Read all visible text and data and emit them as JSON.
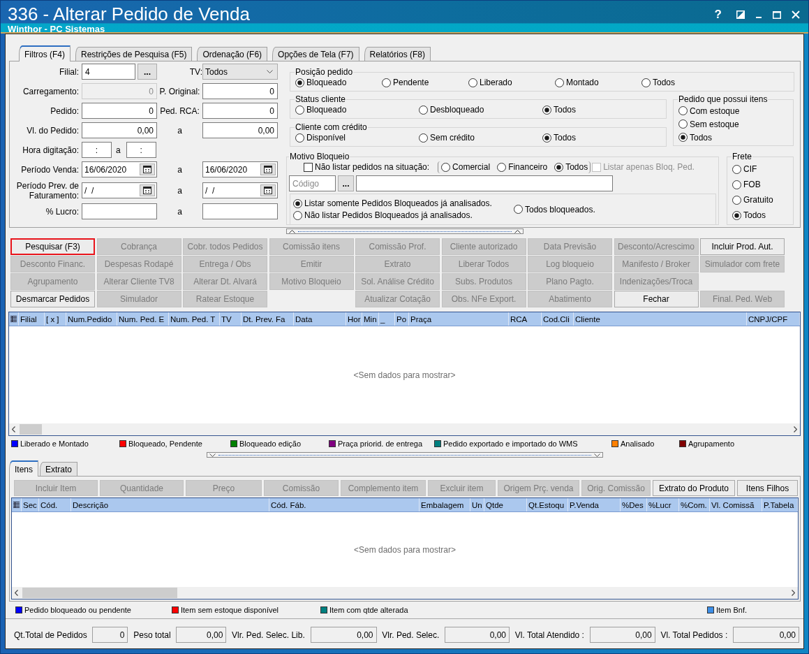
{
  "window": {
    "title": "336 - Alterar Pedido de Venda",
    "subtitle": "Winthor - PC Sistemas",
    "help": "?"
  },
  "tabs": [
    {
      "label": "Filtros (F4)",
      "selected": true
    },
    {
      "label": "Restrições de Pesquisa (F5)",
      "selected": false
    },
    {
      "label": "Ordenação (F6)",
      "selected": false
    },
    {
      "label": "Opções de Tela (F7)",
      "selected": false
    },
    {
      "label": "Relatórios (F8)",
      "selected": false
    }
  ],
  "filters": {
    "rows": [
      {
        "kind": "lookup",
        "label": "Filial:",
        "value": "4",
        "button": "...",
        "label_2": "TV:",
        "select": "Todos"
      },
      {
        "kind": "fields",
        "label": "Carregamento:",
        "from": {
          "value": "0",
          "disabled": true
        },
        "separator": "P. Original:",
        "to": {
          "value": "0",
          "disabled": false
        }
      },
      {
        "kind": "fields",
        "label": "Pedido:",
        "from": {
          "value": "0",
          "disabled": false
        },
        "separator": "Ped. RCA:",
        "to": {
          "value": "0",
          "disabled": false
        }
      },
      {
        "kind": "fields",
        "label": "Vl. do Pedido:",
        "from": {
          "value": "0,00",
          "disabled": false
        },
        "separator": "a",
        "to": {
          "value": "0,00",
          "disabled": false
        }
      },
      {
        "kind": "time",
        "label": "Hora digitação:",
        "from": {
          "value": ":"
        },
        "separator": "a",
        "to": {
          "value": ":"
        }
      },
      {
        "kind": "date",
        "label": "Período Venda:",
        "from": {
          "value": "16/06/2020"
        },
        "separator": "a",
        "to": {
          "value": "16/06/2020"
        }
      },
      {
        "kind": "date",
        "label": "Período Prev. de Faturamento:",
        "from": {
          "value": "/  /"
        },
        "separator": "a",
        "to": {
          "value": "/  /"
        }
      },
      {
        "kind": "fields",
        "label": "% Lucro:",
        "from": {
          "disabled": false
        },
        "separator": "a",
        "to": {
          "disabled": false
        }
      }
    ]
  },
  "order_position": {
    "legend": "Posição pedido",
    "options": [
      {
        "label": "Bloqueado",
        "selected": true
      },
      {
        "label": "Pendente",
        "selected": false
      },
      {
        "label": "Liberado",
        "selected": false
      },
      {
        "label": "Montado",
        "selected": false
      },
      {
        "label": "Todos",
        "selected": false
      }
    ]
  },
  "client_status": {
    "legend": "Status cliente",
    "options": [
      {
        "label": "Bloqueado",
        "selected": false
      },
      {
        "label": "Desbloqueado",
        "selected": false
      },
      {
        "label": "Todos",
        "selected": true
      }
    ]
  },
  "client_credit": {
    "legend": "Cliente com crédito",
    "options": [
      {
        "label": "Disponível",
        "selected": false
      },
      {
        "label": "Sem crédito",
        "selected": false
      },
      {
        "label": "Todos",
        "selected": true
      }
    ]
  },
  "order_items": {
    "legend": "Pedido que possui itens",
    "options": [
      {
        "label": "Com estoque",
        "selected": false
      },
      {
        "label": "Sem estoque",
        "selected": false
      },
      {
        "label": "Todos",
        "selected": true
      }
    ]
  },
  "block_reason": {
    "legend": "Motivo Bloqueio",
    "exclude": {
      "label": "Não listar pedidos na situação:",
      "checked": false
    },
    "situation": [
      {
        "label": "Comercial",
        "selected": false
      },
      {
        "label": "Financeiro",
        "selected": false
      },
      {
        "label": "Todos",
        "selected": true
      }
    ],
    "only_blocked": {
      "label": "Listar apenas Bloq. Ped.",
      "checked": false,
      "disabled": true
    },
    "code": {
      "placeholder": "Código",
      "button": "..."
    },
    "analysis": [
      {
        "label": "Listar somente Pedidos Bloqueados já analisados.",
        "selected": true
      },
      {
        "label": "Não listar Pedidos Bloqueados já analisados.",
        "selected": false
      },
      {
        "label": "Todos bloqueados.",
        "selected": false
      }
    ]
  },
  "freight": {
    "legend": "Frete",
    "options": [
      {
        "label": "CIF",
        "selected": false
      },
      {
        "label": "FOB",
        "selected": false
      },
      {
        "label": "Gratuito",
        "selected": false
      },
      {
        "label": "Todos",
        "selected": true
      }
    ]
  },
  "actions": {
    "rows": [
      [
        {
          "kind": "button",
          "label": "Pesquisar (F3)",
          "disabled": false,
          "highlighted": true
        },
        {
          "kind": "button",
          "label": "Cobrança",
          "disabled": true,
          "highlighted": false
        },
        {
          "kind": "button",
          "label": "Cobr. todos Pedidos",
          "disabled": true,
          "highlighted": false
        },
        {
          "kind": "button",
          "label": "Comissão itens",
          "disabled": true,
          "highlighted": false
        },
        {
          "kind": "button",
          "label": "Comissão Prof.",
          "disabled": true,
          "highlighted": false
        },
        {
          "kind": "button",
          "label": "Cliente autorizado",
          "disabled": true,
          "highlighted": false
        },
        {
          "kind": "button",
          "label": "Data Previsão",
          "disabled": true,
          "highlighted": false
        },
        {
          "kind": "button",
          "label": "Desconto/Acrescimo",
          "disabled": true,
          "highlighted": false
        },
        {
          "kind": "button",
          "label": "Incluir Prod. Aut.",
          "disabled": false,
          "highlighted": false
        }
      ],
      [
        {
          "kind": "button",
          "label": "Desconto Financ.",
          "disabled": true,
          "highlighted": false
        },
        {
          "kind": "button",
          "label": "Despesas Rodapé",
          "disabled": true,
          "highlighted": false
        },
        {
          "kind": "button",
          "label": "Entrega / Obs",
          "disabled": true,
          "highlighted": false
        },
        {
          "kind": "button",
          "label": "Emitir",
          "disabled": true,
          "highlighted": false
        },
        {
          "kind": "button",
          "label": "Extrato",
          "disabled": true,
          "highlighted": false
        },
        {
          "kind": "button",
          "label": "Liberar Todos",
          "disabled": true,
          "highlighted": false
        },
        {
          "kind": "button",
          "label": "Log bloqueio",
          "disabled": true,
          "highlighted": false
        },
        {
          "kind": "button",
          "label": "Manifesto / Broker",
          "disabled": true,
          "highlighted": false
        },
        {
          "kind": "button",
          "label": "Simulador com frete",
          "disabled": true,
          "highlighted": false
        }
      ],
      [
        {
          "kind": "button",
          "label": "Agrupamento",
          "disabled": true,
          "highlighted": false
        },
        {
          "kind": "button",
          "label": "Alterar Cliente TV8",
          "disabled": true,
          "highlighted": false
        },
        {
          "kind": "button",
          "label": "Alterar Dt. Alvará",
          "disabled": true,
          "highlighted": false
        },
        {
          "kind": "button",
          "label": "Motivo Bloqueio",
          "disabled": true,
          "highlighted": false
        },
        {
          "kind": "button",
          "label": "Sol. Análise Crédito",
          "disabled": true,
          "highlighted": false
        },
        {
          "kind": "button",
          "label": "Subs. Produtos",
          "disabled": true,
          "highlighted": false
        },
        {
          "kind": "button",
          "label": "Plano Pagto.",
          "disabled": true,
          "highlighted": false
        },
        {
          "kind": "button",
          "label": "Indenizações/Troca",
          "disabled": true,
          "highlighted": false
        },
        {
          "kind": "spacer"
        }
      ],
      [
        {
          "kind": "button",
          "label": "Desmarcar Pedidos",
          "disabled": false,
          "highlighted": false
        },
        {
          "kind": "button",
          "label": "Simulador",
          "disabled": true,
          "highlighted": false
        },
        {
          "kind": "button",
          "label": "Ratear Estoque",
          "disabled": true,
          "highlighted": false
        },
        {
          "kind": "spacer"
        },
        {
          "kind": "button",
          "label": "Atualizar Cotação",
          "disabled": true,
          "highlighted": false
        },
        {
          "kind": "button",
          "label": "Obs. NFe Export.",
          "disabled": true,
          "highlighted": false
        },
        {
          "kind": "button",
          "label": "Abatimento",
          "disabled": true,
          "highlighted": false
        },
        {
          "kind": "button",
          "label": "Fechar",
          "disabled": false,
          "highlighted": false
        },
        {
          "kind": "button",
          "label": "Final. Ped. Web",
          "disabled": true,
          "highlighted": false
        }
      ]
    ]
  },
  "orders_table": {
    "columns": [
      "Filial",
      "[ x ]",
      "Num.Pedido",
      "Num. Ped. E",
      "Num. Ped. T",
      "TV",
      "Dt. Prev. Fa",
      "Data",
      "Hor",
      "Min",
      "_",
      "Po",
      "Praça",
      "RCA",
      "Cod.Cli",
      "Cliente",
      "CNPJ/CPF"
    ],
    "empty_text": "<Sem dados para mostrar>"
  },
  "order_legend": [
    {
      "label": "Liberado e Montado",
      "color": "#0000ff"
    },
    {
      "label": "Bloqueado, Pendente",
      "color": "#ff0000"
    },
    {
      "label": "Bloqueado edição",
      "color": "#008000"
    },
    {
      "label": "Praça priorid. de entrega",
      "color": "#800080"
    },
    {
      "label": "Pedido exportado e importado do WMS",
      "color": "#008080"
    },
    {
      "label": "Analisado",
      "color": "#ff8000"
    },
    {
      "label": "Agrupamento",
      "color": "#800000"
    }
  ],
  "item_tabs": [
    {
      "label": "Itens",
      "selected": true
    },
    {
      "label": "Extrato",
      "selected": false
    }
  ],
  "item_actions": [
    {
      "label": "Incluir Item",
      "disabled": true
    },
    {
      "label": "Quantidade",
      "disabled": true
    },
    {
      "label": "Preço",
      "disabled": true
    },
    {
      "label": "Comissão",
      "disabled": true
    },
    {
      "label": "Complemento item",
      "disabled": true
    },
    {
      "label": "Excluir item",
      "disabled": true
    },
    {
      "label": "Origem Prç. venda",
      "disabled": true
    },
    {
      "label": "Orig. Comissão",
      "disabled": true
    },
    {
      "label": "Extrato do Produto",
      "disabled": false
    },
    {
      "label": "Itens Filhos",
      "disabled": false
    }
  ],
  "items_table": {
    "columns": [
      "Sec",
      "Cód.",
      "Descrição",
      "Cód. Fáb.",
      "Embalagem",
      "Un",
      "Qtde",
      "Qt.Estoqu",
      "P.Venda",
      "%Des",
      "%Lucr",
      "%Com.",
      "Vl. Comissã",
      "P.Tabela"
    ],
    "empty_text": "<Sem dados para mostrar>"
  },
  "item_legend": [
    {
      "label": "Pedido bloqueado ou pendente",
      "color": "#0000ff"
    },
    {
      "label": "Item sem estoque disponível",
      "color": "#ff0000"
    },
    {
      "label": "Item com qtde alterada",
      "color": "#008080"
    },
    {
      "label": "Item Bnf.",
      "color": "#3d8ee6"
    }
  ],
  "totals": [
    {
      "label": "Qt.Total de Pedidos",
      "value": "0"
    },
    {
      "label": "Peso total",
      "value": "0,00"
    },
    {
      "label": "Vlr. Ped. Selec. Lib.",
      "value": "0,00"
    },
    {
      "label": "Vlr. Ped. Selec.",
      "value": "0,00"
    },
    {
      "label": "Vl. Total Atendido :",
      "value": "0,00"
    },
    {
      "label": "Vl. Total Pedidos :",
      "value": "0,00"
    }
  ]
}
